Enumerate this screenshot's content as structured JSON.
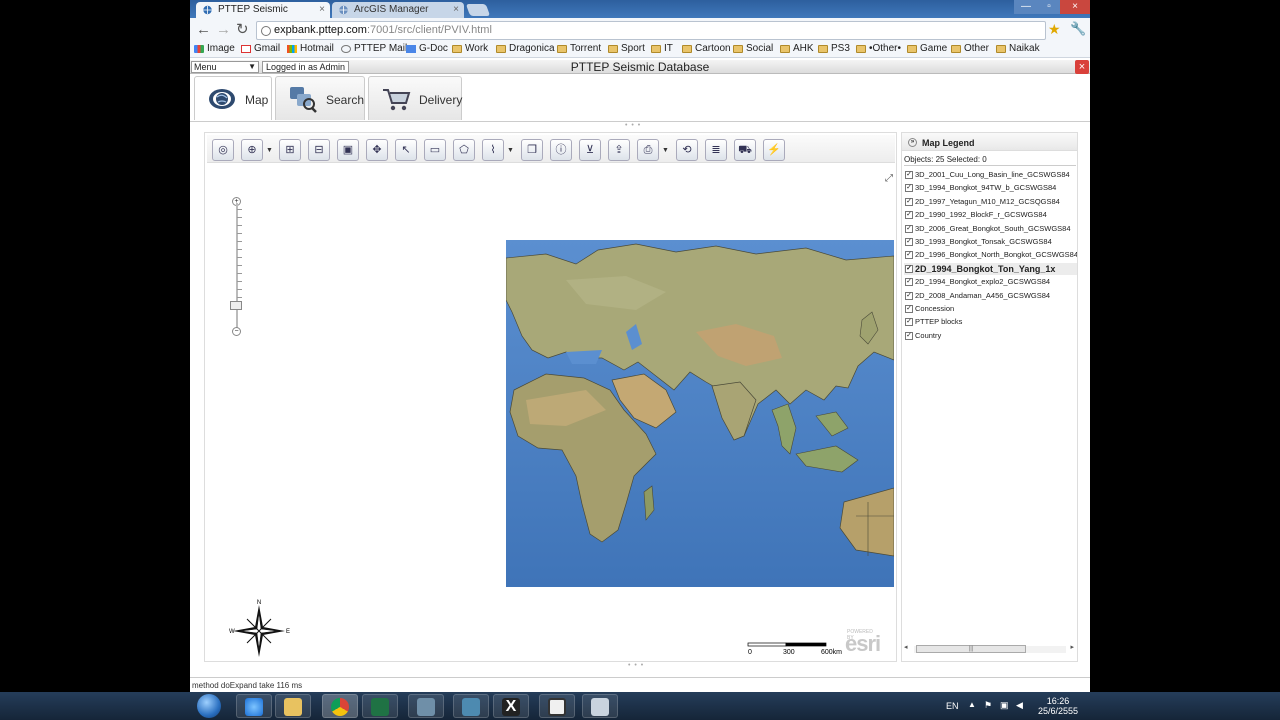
{
  "browser": {
    "tabs": [
      {
        "label": "PTTEP Seismic",
        "active": true
      },
      {
        "label": "ArcGIS Manager",
        "active": false
      }
    ],
    "tab_close_glyph": "×",
    "url_host": "expbank.pttep.com",
    "url_path": ":7001/src/client/PVIV.html",
    "bookmarks": [
      {
        "label": "Image",
        "icon": "google-icon"
      },
      {
        "label": "Gmail",
        "icon": "gmail-icon"
      },
      {
        "label": "Hotmail",
        "icon": "hotmail-icon"
      },
      {
        "label": "PTTEP Mail",
        "icon": "globe-icon"
      },
      {
        "label": "G-Doc",
        "icon": "docs-icon"
      },
      {
        "label": "Work",
        "icon": "folder-icon"
      },
      {
        "label": "Dragonica",
        "icon": "folder-icon"
      },
      {
        "label": "Torrent",
        "icon": "folder-icon"
      },
      {
        "label": "Sport",
        "icon": "folder-icon"
      },
      {
        "label": "IT",
        "icon": "folder-icon"
      },
      {
        "label": "Cartoon",
        "icon": "folder-icon"
      },
      {
        "label": "Social",
        "icon": "folder-icon"
      },
      {
        "label": "AHK",
        "icon": "folder-icon"
      },
      {
        "label": "PS3",
        "icon": "folder-icon"
      },
      {
        "label": "•Other•",
        "icon": "folder-icon"
      },
      {
        "label": "Game",
        "icon": "folder-icon"
      },
      {
        "label": "Other",
        "icon": "folder-icon"
      },
      {
        "label": "Naikak",
        "icon": "folder-icon"
      }
    ]
  },
  "app": {
    "menu_label": "Menu",
    "logged_in": "Logged in as Admin",
    "title": "PTTEP Seismic Database",
    "close_glyph": "×",
    "nav_tabs": [
      {
        "label": "Map",
        "icon": "globe-icon",
        "selected": true
      },
      {
        "label": "Search",
        "icon": "search-icon",
        "selected": false
      },
      {
        "label": "Delivery",
        "icon": "cart-icon",
        "selected": false
      }
    ],
    "status_text": "method doExpand take 116 ms"
  },
  "map": {
    "zoom_level": 0.2,
    "scale_labels": [
      "0",
      "300",
      "600km"
    ],
    "compass_labels": {
      "n": "N",
      "w": "W",
      "e": "E"
    },
    "esri_text": "esri",
    "esri_caption": "POWERED BY"
  },
  "legend": {
    "title": "Map Legend",
    "objects_text": "Objects: 25 Selected: 0",
    "layers": [
      {
        "label": "3D_2001_Cuu_Long_Basin_line_GCSWGS84",
        "checked": true
      },
      {
        "label": "3D_1994_Bongkot_94TW_b_GCSWGS84",
        "checked": true
      },
      {
        "label": "2D_1997_Yetagun_M10_M12_GCSQGS84",
        "checked": true
      },
      {
        "label": "2D_1990_1992_BlockF_r_GCSWGS84",
        "checked": true
      },
      {
        "label": "3D_2006_Great_Bongkot_South_GCSWGS84",
        "checked": true
      },
      {
        "label": "3D_1993_Bongkot_Tonsak_GCSWGS84",
        "checked": true
      },
      {
        "label": "2D_1996_Bongkot_North_Bongkot_GCSWGS84",
        "checked": true
      },
      {
        "label": "2D_1994_Bongkot_Ton_Yang_1x",
        "checked": true,
        "highlighted": true
      },
      {
        "label": "2D_1994_Bongkot_explo2_GCSWGS84",
        "checked": true
      },
      {
        "label": "2D_2008_Andaman_A456_GCSWGS84",
        "checked": true
      },
      {
        "label": "Concession",
        "checked": true
      },
      {
        "label": "PTTEP blocks",
        "checked": true
      },
      {
        "label": "Country",
        "checked": true
      }
    ]
  },
  "taskbar": {
    "language": "EN",
    "time": "16:26",
    "date": "25/6/2555"
  },
  "colors": {
    "title_bar": "#3f78bb",
    "ocean": "#4a7fc1",
    "land": "#a8a878",
    "app_close": "#d9403a"
  }
}
